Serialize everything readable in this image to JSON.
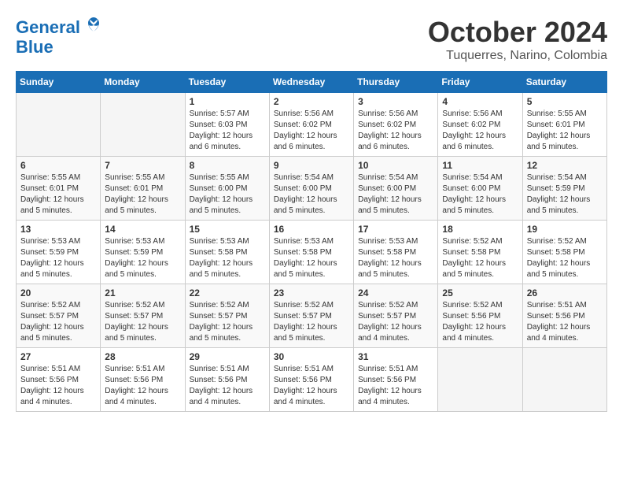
{
  "header": {
    "logo_line1": "General",
    "logo_line2": "Blue",
    "month": "October 2024",
    "location": "Tuquerres, Narino, Colombia"
  },
  "weekdays": [
    "Sunday",
    "Monday",
    "Tuesday",
    "Wednesday",
    "Thursday",
    "Friday",
    "Saturday"
  ],
  "weeks": [
    [
      {
        "day": "",
        "info": ""
      },
      {
        "day": "",
        "info": ""
      },
      {
        "day": "1",
        "info": "Sunrise: 5:57 AM\nSunset: 6:03 PM\nDaylight: 12 hours\nand 6 minutes."
      },
      {
        "day": "2",
        "info": "Sunrise: 5:56 AM\nSunset: 6:02 PM\nDaylight: 12 hours\nand 6 minutes."
      },
      {
        "day": "3",
        "info": "Sunrise: 5:56 AM\nSunset: 6:02 PM\nDaylight: 12 hours\nand 6 minutes."
      },
      {
        "day": "4",
        "info": "Sunrise: 5:56 AM\nSunset: 6:02 PM\nDaylight: 12 hours\nand 6 minutes."
      },
      {
        "day": "5",
        "info": "Sunrise: 5:55 AM\nSunset: 6:01 PM\nDaylight: 12 hours\nand 5 minutes."
      }
    ],
    [
      {
        "day": "6",
        "info": "Sunrise: 5:55 AM\nSunset: 6:01 PM\nDaylight: 12 hours\nand 5 minutes."
      },
      {
        "day": "7",
        "info": "Sunrise: 5:55 AM\nSunset: 6:01 PM\nDaylight: 12 hours\nand 5 minutes."
      },
      {
        "day": "8",
        "info": "Sunrise: 5:55 AM\nSunset: 6:00 PM\nDaylight: 12 hours\nand 5 minutes."
      },
      {
        "day": "9",
        "info": "Sunrise: 5:54 AM\nSunset: 6:00 PM\nDaylight: 12 hours\nand 5 minutes."
      },
      {
        "day": "10",
        "info": "Sunrise: 5:54 AM\nSunset: 6:00 PM\nDaylight: 12 hours\nand 5 minutes."
      },
      {
        "day": "11",
        "info": "Sunrise: 5:54 AM\nSunset: 6:00 PM\nDaylight: 12 hours\nand 5 minutes."
      },
      {
        "day": "12",
        "info": "Sunrise: 5:54 AM\nSunset: 5:59 PM\nDaylight: 12 hours\nand 5 minutes."
      }
    ],
    [
      {
        "day": "13",
        "info": "Sunrise: 5:53 AM\nSunset: 5:59 PM\nDaylight: 12 hours\nand 5 minutes."
      },
      {
        "day": "14",
        "info": "Sunrise: 5:53 AM\nSunset: 5:59 PM\nDaylight: 12 hours\nand 5 minutes."
      },
      {
        "day": "15",
        "info": "Sunrise: 5:53 AM\nSunset: 5:58 PM\nDaylight: 12 hours\nand 5 minutes."
      },
      {
        "day": "16",
        "info": "Sunrise: 5:53 AM\nSunset: 5:58 PM\nDaylight: 12 hours\nand 5 minutes."
      },
      {
        "day": "17",
        "info": "Sunrise: 5:53 AM\nSunset: 5:58 PM\nDaylight: 12 hours\nand 5 minutes."
      },
      {
        "day": "18",
        "info": "Sunrise: 5:52 AM\nSunset: 5:58 PM\nDaylight: 12 hours\nand 5 minutes."
      },
      {
        "day": "19",
        "info": "Sunrise: 5:52 AM\nSunset: 5:58 PM\nDaylight: 12 hours\nand 5 minutes."
      }
    ],
    [
      {
        "day": "20",
        "info": "Sunrise: 5:52 AM\nSunset: 5:57 PM\nDaylight: 12 hours\nand 5 minutes."
      },
      {
        "day": "21",
        "info": "Sunrise: 5:52 AM\nSunset: 5:57 PM\nDaylight: 12 hours\nand 5 minutes."
      },
      {
        "day": "22",
        "info": "Sunrise: 5:52 AM\nSunset: 5:57 PM\nDaylight: 12 hours\nand 5 minutes."
      },
      {
        "day": "23",
        "info": "Sunrise: 5:52 AM\nSunset: 5:57 PM\nDaylight: 12 hours\nand 5 minutes."
      },
      {
        "day": "24",
        "info": "Sunrise: 5:52 AM\nSunset: 5:57 PM\nDaylight: 12 hours\nand 4 minutes."
      },
      {
        "day": "25",
        "info": "Sunrise: 5:52 AM\nSunset: 5:56 PM\nDaylight: 12 hours\nand 4 minutes."
      },
      {
        "day": "26",
        "info": "Sunrise: 5:51 AM\nSunset: 5:56 PM\nDaylight: 12 hours\nand 4 minutes."
      }
    ],
    [
      {
        "day": "27",
        "info": "Sunrise: 5:51 AM\nSunset: 5:56 PM\nDaylight: 12 hours\nand 4 minutes."
      },
      {
        "day": "28",
        "info": "Sunrise: 5:51 AM\nSunset: 5:56 PM\nDaylight: 12 hours\nand 4 minutes."
      },
      {
        "day": "29",
        "info": "Sunrise: 5:51 AM\nSunset: 5:56 PM\nDaylight: 12 hours\nand 4 minutes."
      },
      {
        "day": "30",
        "info": "Sunrise: 5:51 AM\nSunset: 5:56 PM\nDaylight: 12 hours\nand 4 minutes."
      },
      {
        "day": "31",
        "info": "Sunrise: 5:51 AM\nSunset: 5:56 PM\nDaylight: 12 hours\nand 4 minutes."
      },
      {
        "day": "",
        "info": ""
      },
      {
        "day": "",
        "info": ""
      }
    ]
  ]
}
